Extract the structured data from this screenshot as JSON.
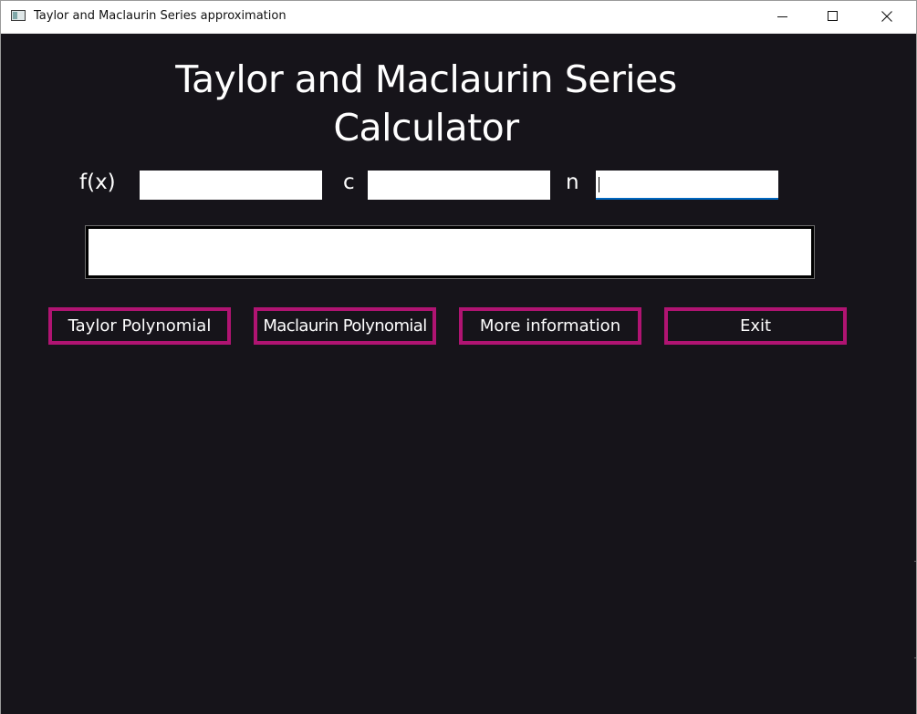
{
  "window": {
    "title": "Taylor and Maclaurin Series approximation",
    "icon": "app-window-icon",
    "controls": [
      "minimize-icon",
      "maximize-icon",
      "close-icon"
    ]
  },
  "main": {
    "heading": "Taylor and Maclaurin Series Calculator",
    "fields": {
      "fx_label": "f(x)",
      "fx_value": "",
      "c_label": "c",
      "c_value": "",
      "n_label": "n",
      "n_value": ""
    },
    "output_text": "",
    "buttons": {
      "taylor": "Taylor Polynomial",
      "maclaurin": "Maclaurin Polynomial",
      "info": "More information",
      "exit": "Exit"
    }
  },
  "colors": {
    "background": "#16141a",
    "button_border": "#b01472",
    "text": "#ffffff",
    "focus_underline": "#0067c0"
  }
}
